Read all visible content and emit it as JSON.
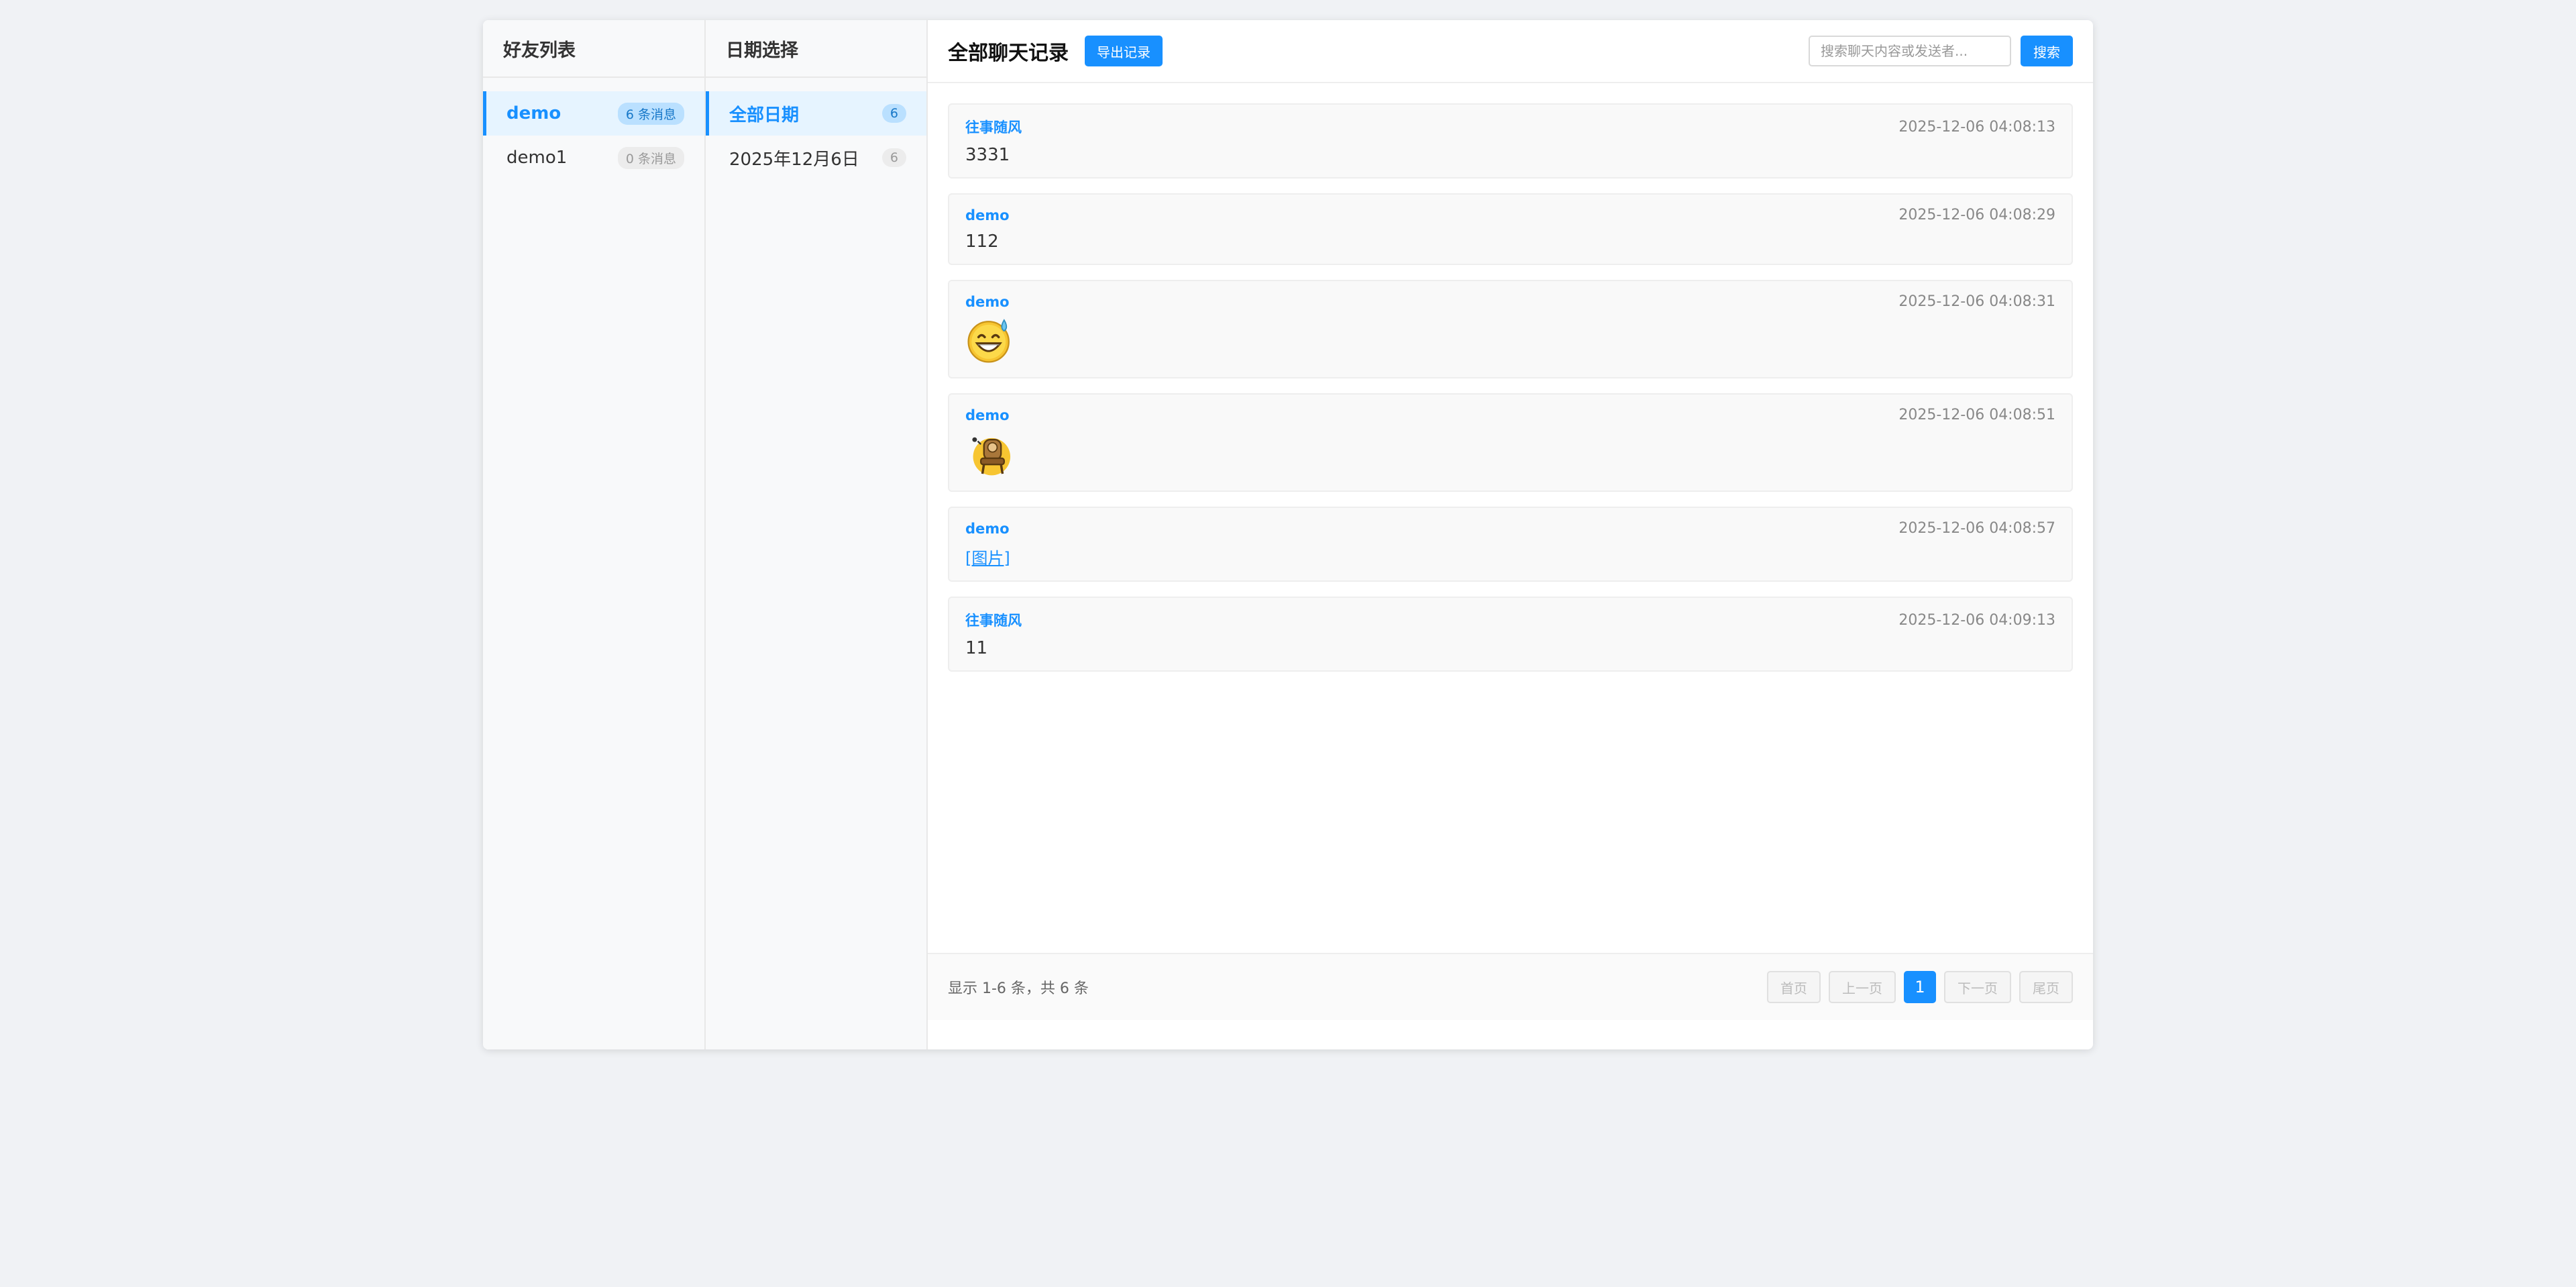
{
  "friends": {
    "title": "好友列表",
    "items": [
      {
        "name": "demo",
        "count": "6 条消息",
        "active": true
      },
      {
        "name": "demo1",
        "count": "0 条消息",
        "active": false
      }
    ]
  },
  "dates": {
    "title": "日期选择",
    "items": [
      {
        "label": "全部日期",
        "count": "6",
        "active": true
      },
      {
        "label": "2025年12月6日",
        "count": "6",
        "active": false
      }
    ]
  },
  "main": {
    "title": "全部聊天记录",
    "export_label": "导出记录",
    "search_placeholder": "搜索聊天内容或发送者...",
    "search_label": "搜索"
  },
  "messages": [
    {
      "sender": "往事随风",
      "time": "2025-12-06 04:08:13",
      "text": "3331"
    },
    {
      "sender": "demo",
      "time": "2025-12-06 04:08:29",
      "text": "112"
    },
    {
      "sender": "demo",
      "time": "2025-12-06 04:08:31",
      "emoji": "grinning-sweat-emoji"
    },
    {
      "sender": "demo",
      "time": "2025-12-06 04:08:51",
      "emoji": "chair-sticker-emoji"
    },
    {
      "sender": "demo",
      "time": "2025-12-06 04:08:57",
      "link": "[图片]"
    },
    {
      "sender": "往事随风",
      "time": "2025-12-06 04:09:13",
      "text": "11"
    }
  ],
  "pager": {
    "info": "显示 1-6 条，共 6 条",
    "first": "首页",
    "prev": "上一页",
    "current": "1",
    "next": "下一页",
    "last": "尾页"
  },
  "colors": {
    "accent": "#1890ff",
    "background": "#f0f2f5"
  }
}
